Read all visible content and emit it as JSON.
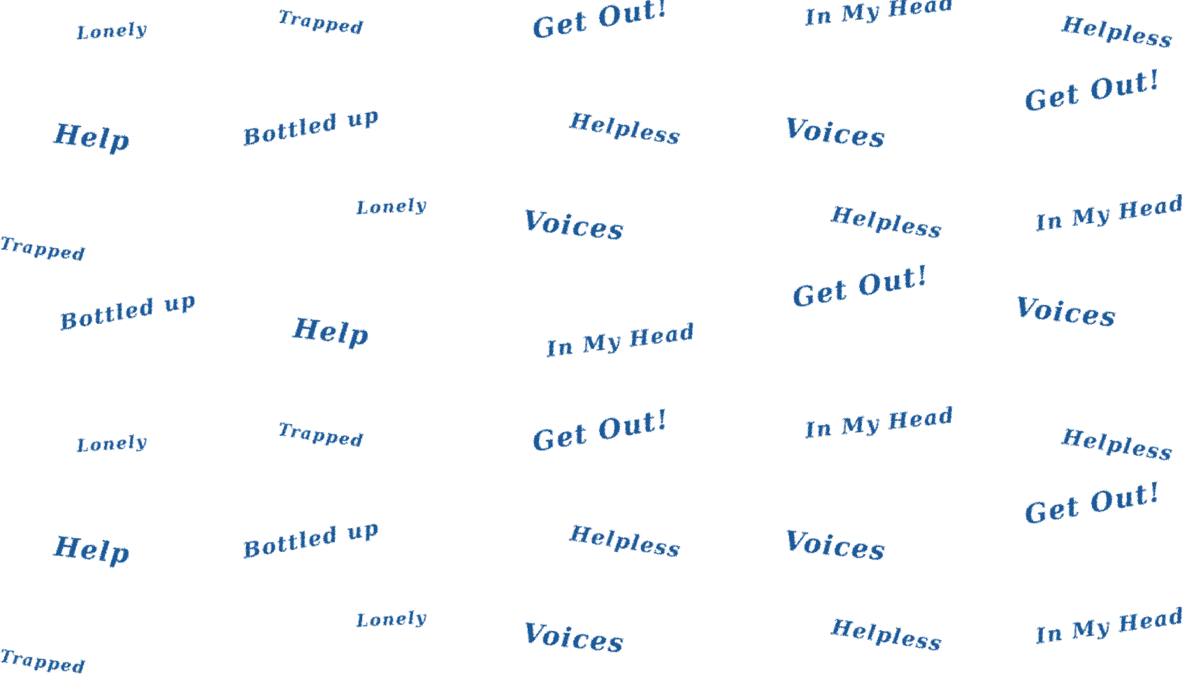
{
  "pattern": {
    "color": "#1f5a9a",
    "background": "#ffffff",
    "words": [
      "Lonely",
      "Trapped",
      "Get Out!",
      "In My Head",
      "Helpless",
      "Help",
      "Bottled up",
      "Helpless",
      "Voices",
      "Get Out!",
      "Lonely",
      "Voices",
      "Helpless",
      "In My Head",
      "Trapped",
      "Bottled up",
      "Help",
      "In My Head",
      "Get Out!",
      "Voices",
      "Lonely",
      "Trapped",
      "Get Out!",
      "In My Head",
      "Helpless",
      "Help",
      "Bottled up",
      "Helpless",
      "Voices",
      "Get Out!",
      "Lonely",
      "Voices",
      "Helpless",
      "In My Head",
      "Trapped"
    ]
  }
}
